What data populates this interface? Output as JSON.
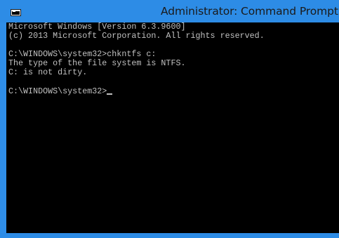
{
  "window": {
    "title": "Administrator: Command Prompt",
    "icon": "cmd-app-icon",
    "frame_color": "#2d8ce6"
  },
  "console": {
    "background": "#000000",
    "foreground": "#c0c0c0",
    "lines": [
      "Microsoft Windows [Version 6.3.9600]",
      "(c) 2013 Microsoft Corporation. All rights reserved.",
      "",
      "C:\\WINDOWS\\system32>chkntfs c:",
      "The type of the file system is NTFS.",
      "C: is not dirty.",
      "",
      "C:\\WINDOWS\\system32>"
    ]
  }
}
